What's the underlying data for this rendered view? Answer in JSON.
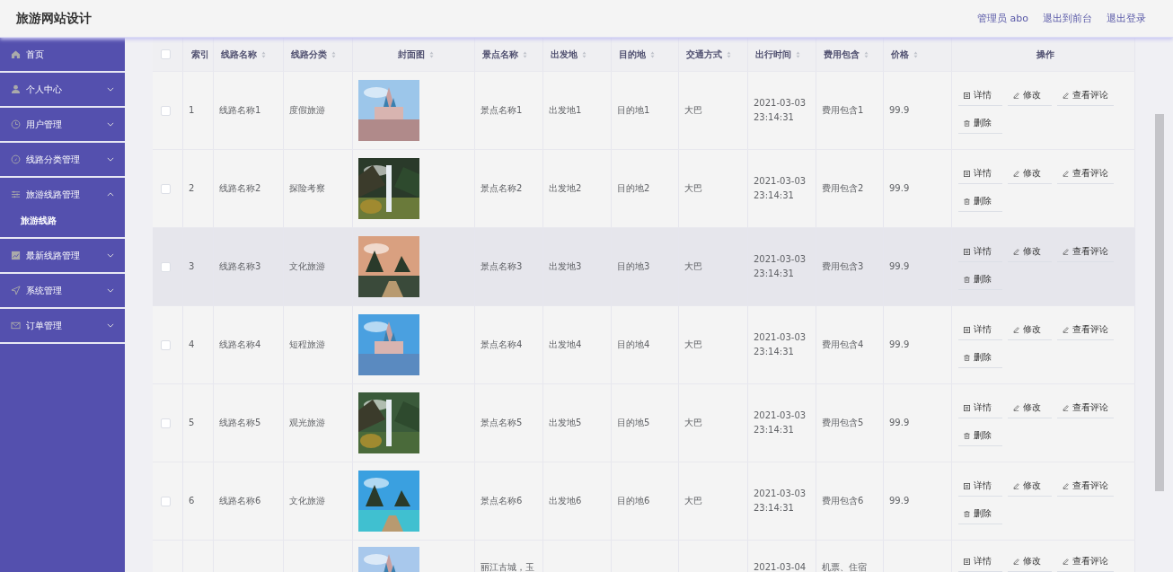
{
  "header": {
    "title": "旅游网站设计",
    "links": [
      "管理员 abo",
      "退出到前台",
      "退出登录"
    ]
  },
  "sidebar": {
    "items": [
      {
        "label": "首页"
      },
      {
        "label": "个人中心",
        "expanded": false
      },
      {
        "label": "用户管理",
        "expanded": false
      },
      {
        "label": "线路分类管理",
        "expanded": false
      },
      {
        "label": "旅游线路管理",
        "expanded": true,
        "children": [
          {
            "label": "旅游线路"
          }
        ]
      },
      {
        "label": "最新线路管理",
        "expanded": false
      },
      {
        "label": "系统管理",
        "expanded": false
      },
      {
        "label": "订单管理",
        "expanded": false
      }
    ]
  },
  "table": {
    "header_checked": false,
    "columns": [
      {
        "label": "索引",
        "sortable": false
      },
      {
        "label": "线路名称",
        "sortable": true
      },
      {
        "label": "线路分类",
        "sortable": true
      },
      {
        "label": "封面图",
        "sortable": true
      },
      {
        "label": "景点名称",
        "sortable": true
      },
      {
        "label": "出发地",
        "sortable": true
      },
      {
        "label": "目的地",
        "sortable": true
      },
      {
        "label": "交通方式",
        "sortable": true
      },
      {
        "label": "出行时间",
        "sortable": true
      },
      {
        "label": "费用包含",
        "sortable": true
      },
      {
        "label": "价格",
        "sortable": true
      },
      {
        "label": "操作",
        "sortable": false
      }
    ],
    "rows": [
      {
        "checked": false,
        "highlighted": false,
        "index": "1",
        "name": "线路名称1",
        "category": "度假旅游",
        "cover": {
          "kind": "picture"
        },
        "scenic": "景点名称1",
        "from": "出发地1",
        "to": "目的地1",
        "transport": "大巴",
        "time": [
          "2021-03-03",
          "23:14:31"
        ],
        "fees": "费用包含1",
        "price": "99.9",
        "actions": [
          {
            "kind": "detail",
            "label": "详情"
          },
          {
            "kind": "edit",
            "label": "修改"
          },
          {
            "kind": "edit",
            "label": "查看评论"
          },
          {
            "kind": "delete",
            "label": "删除"
          }
        ]
      },
      {
        "checked": false,
        "highlighted": false,
        "index": "2",
        "name": "线路名称2",
        "category": "探险考察",
        "cover": {
          "kind": "picture"
        },
        "scenic": "景点名称2",
        "from": "出发地2",
        "to": "目的地2",
        "transport": "大巴",
        "time": [
          "2021-03-03",
          "23:14:31"
        ],
        "fees": "费用包含2",
        "price": "99.9",
        "actions": [
          {
            "kind": "detail",
            "label": "详情"
          },
          {
            "kind": "edit",
            "label": "修改"
          },
          {
            "kind": "edit",
            "label": "查看评论"
          },
          {
            "kind": "delete",
            "label": "删除"
          }
        ]
      },
      {
        "checked": false,
        "highlighted": true,
        "index": "3",
        "name": "线路名称3",
        "category": "文化旅游",
        "cover": {
          "kind": "picture"
        },
        "scenic": "景点名称3",
        "from": "出发地3",
        "to": "目的地3",
        "transport": "大巴",
        "time": [
          "2021-03-03",
          "23:14:31"
        ],
        "fees": "费用包含3",
        "price": "99.9",
        "actions": [
          {
            "kind": "detail",
            "label": "详情"
          },
          {
            "kind": "edit",
            "label": "修改"
          },
          {
            "kind": "edit",
            "label": "查看评论"
          },
          {
            "kind": "delete",
            "label": "删除"
          }
        ]
      },
      {
        "checked": false,
        "highlighted": false,
        "index": "4",
        "name": "线路名称4",
        "category": "短程旅游",
        "cover": {
          "kind": "picture"
        },
        "scenic": "景点名称4",
        "from": "出发地4",
        "to": "目的地4",
        "transport": "大巴",
        "time": [
          "2021-03-03",
          "23:14:31"
        ],
        "fees": "费用包含4",
        "price": "99.9",
        "actions": [
          {
            "kind": "detail",
            "label": "详情"
          },
          {
            "kind": "edit",
            "label": "修改"
          },
          {
            "kind": "edit",
            "label": "查看评论"
          },
          {
            "kind": "delete",
            "label": "删除"
          }
        ]
      },
      {
        "checked": false,
        "highlighted": false,
        "index": "5",
        "name": "线路名称5",
        "category": "观光旅游",
        "cover": {
          "kind": "picture"
        },
        "scenic": "景点名称5",
        "from": "出发地5",
        "to": "目的地5",
        "transport": "大巴",
        "time": [
          "2021-03-03",
          "23:14:31"
        ],
        "fees": "费用包含5",
        "price": "99.9",
        "actions": [
          {
            "kind": "detail",
            "label": "详情"
          },
          {
            "kind": "edit",
            "label": "修改"
          },
          {
            "kind": "edit",
            "label": "查看评论"
          },
          {
            "kind": "delete",
            "label": "删除"
          }
        ]
      },
      {
        "checked": false,
        "highlighted": false,
        "index": "6",
        "name": "线路名称6",
        "category": "文化旅游",
        "cover": {
          "kind": "picture"
        },
        "scenic": "景点名称6",
        "from": "出发地6",
        "to": "目的地6",
        "transport": "大巴",
        "time": [
          "2021-03-03",
          "23:14:31"
        ],
        "fees": "费用包含6",
        "price": "99.9",
        "actions": [
          {
            "kind": "detail",
            "label": "详情"
          },
          {
            "kind": "edit",
            "label": "修改"
          },
          {
            "kind": "edit",
            "label": "查看评论"
          },
          {
            "kind": "delete",
            "label": "删除"
          }
        ]
      },
      {
        "highlighted": false,
        "cover": {
          "kind": "picture"
        },
        "scenic": "丽江古城，玉",
        "time": [
          "2021-03-04"
        ],
        "fees": "机票、住宿",
        "actions": [
          {
            "kind": "detail",
            "label": "详情"
          },
          {
            "kind": "edit",
            "label": "修改"
          },
          {
            "kind": "edit",
            "label": "查看评论"
          }
        ]
      }
    ]
  }
}
